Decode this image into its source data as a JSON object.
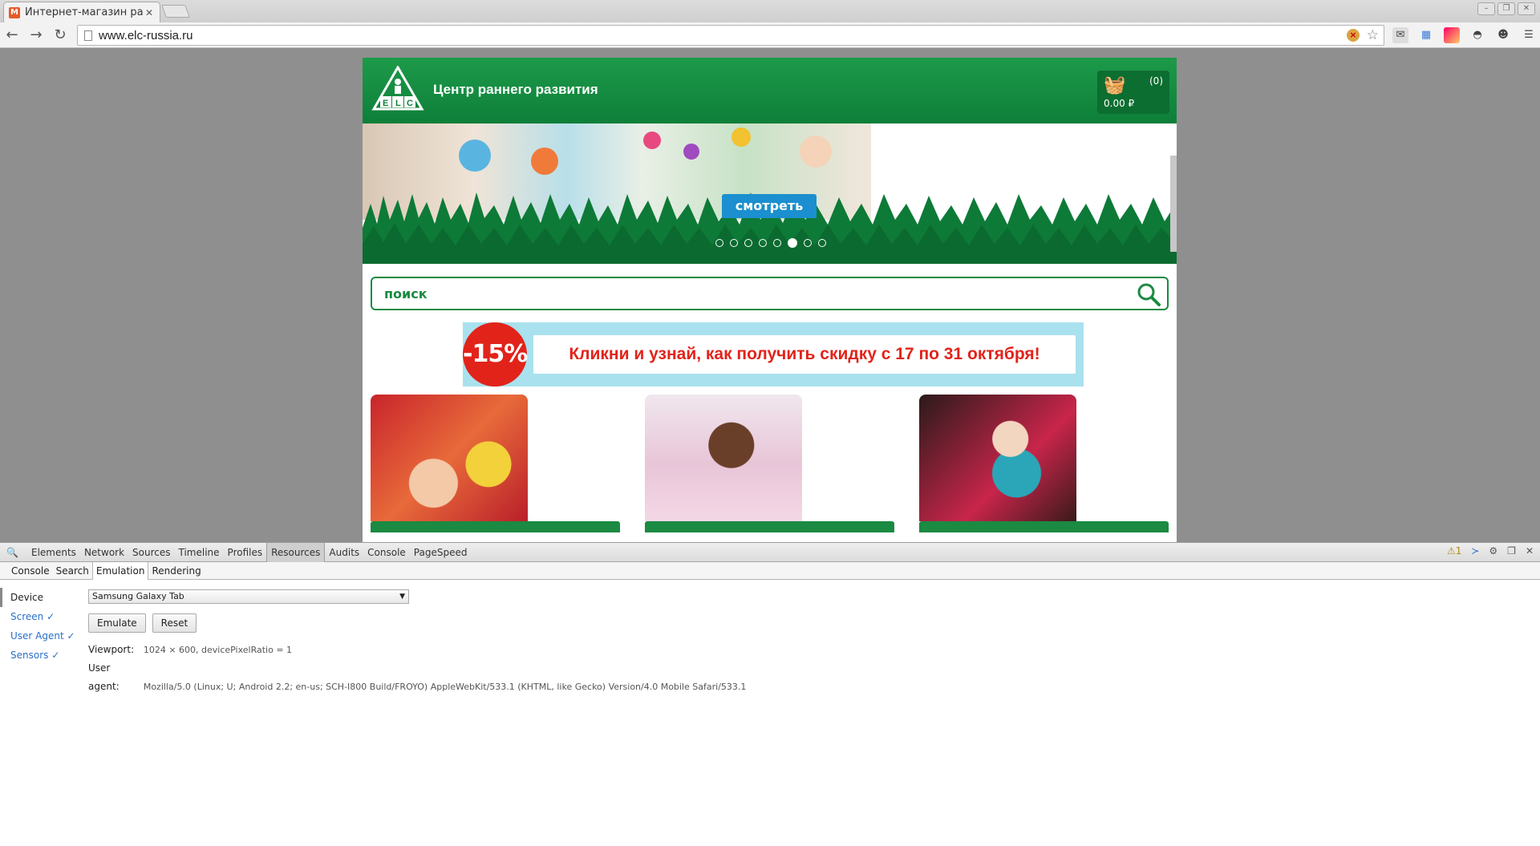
{
  "browser": {
    "tab_title": "Интернет-магазин раз",
    "url": "www.elc-russia.ru"
  },
  "site": {
    "title": "Центр раннего развития",
    "logo_text": "ELC",
    "cart_count": "(0)",
    "cart_total": "0.00 ₽",
    "banner_cta": "смотреть",
    "banner_dots": 8,
    "banner_active_dot": 6,
    "search_placeholder": "поиск",
    "promo_badge": "-15%",
    "promo_text": "Кликни и узнай, как получить скидку с 17 по 31 октября!"
  },
  "devtools": {
    "tabs": [
      "Elements",
      "Network",
      "Sources",
      "Timeline",
      "Profiles",
      "Resources",
      "Audits",
      "Console",
      "PageSpeed"
    ],
    "selected_tab": "Resources",
    "warning_count": "1",
    "drawer_tabs": [
      "Console",
      "Search",
      "Emulation",
      "Rendering"
    ],
    "selected_drawer_tab": "Emulation",
    "emulation_nav": [
      "Device",
      "Screen ✓",
      "User Agent ✓",
      "Sensors ✓"
    ],
    "device": "Samsung Galaxy Tab",
    "emulate_label": "Emulate",
    "reset_label": "Reset",
    "viewport_label": "Viewport:",
    "viewport_value": "1024 × 600, devicePixelRatio = 1",
    "user_agent_label": "User agent:",
    "user_agent_value": "Mozilla/5.0 (Linux; U; Android 2.2; en-us; SCH-I800 Build/FROYO) AppleWebKit/533.1 (KHTML, like Gecko) Version/4.0 Mobile Safari/533.1"
  },
  "colors": {
    "brand_green": "#1b8a42",
    "promo_red": "#e2231a",
    "promo_blue": "#a9e1ee",
    "cta_blue": "#1b8fcf"
  }
}
